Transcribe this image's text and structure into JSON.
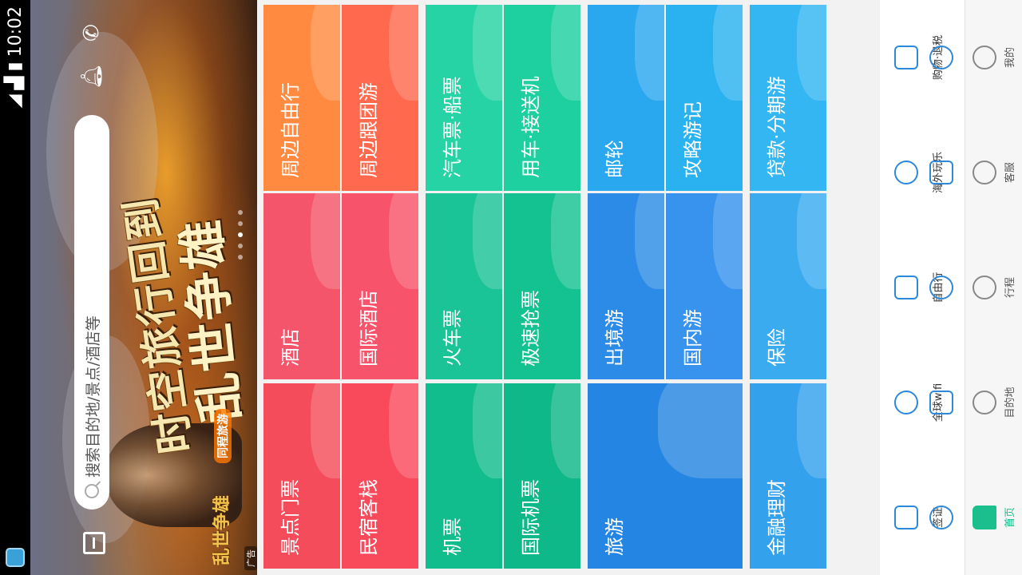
{
  "status_bar": {
    "time": "10:02"
  },
  "search": {
    "placeholder": "搜索目的地/景点/酒店等"
  },
  "banner": {
    "title_line1": "时空旅行回到",
    "title_line2": "乱世争雄",
    "game_logo": "乱世争雄",
    "sponsor": "同程旅游",
    "ad_tag": "广告",
    "page_count": 5,
    "active_page": 2
  },
  "blocks": [
    {
      "color": "#f34b59",
      "tiles": [
        {
          "label": "景点门票",
          "color": "#f44c5a"
        },
        {
          "label": "民宿客栈",
          "color": "#f94a5c"
        },
        {
          "label": "酒店",
          "color": "#f5556a"
        },
        {
          "label": "国际酒店",
          "color": "#f7536a"
        },
        {
          "label": "周边自由行",
          "color": "#ff8a40"
        },
        {
          "label": "周边跟团游",
          "color": "#ff6a4e"
        }
      ]
    },
    {
      "color": "#14c392",
      "tiles": [
        {
          "label": "机票",
          "color": "#12bd8d"
        },
        {
          "label": "国际机票",
          "color": "#0fb889"
        },
        {
          "label": "火车票",
          "color": "#1ac496"
        },
        {
          "label": "极速抢票",
          "color": "#14c291"
        },
        {
          "label": "汽车票·船票",
          "color": "#26d3a4"
        },
        {
          "label": "用车·接送机",
          "color": "#1ed0a0"
        }
      ]
    },
    {
      "color": "#2a90e6",
      "tiles": [
        {
          "label": "旅游",
          "color": "#2486e2"
        },
        {
          "label": "出境游",
          "color": "#2b8be6"
        },
        {
          "label": "国内游",
          "color": "#3893ee"
        },
        {
          "label": "邮轮",
          "color": "#2aa8ef"
        },
        {
          "label": "攻略游记",
          "color": "#2ab2f0"
        }
      ]
    },
    {
      "color": "#35a4ee",
      "tiles": [
        {
          "label": "金融理财",
          "color": "#34a1ec"
        },
        {
          "label": "保险",
          "color": "#3aabef"
        },
        {
          "label": "贷款·分期游",
          "color": "#33b6f2"
        }
      ]
    }
  ],
  "features": [
    {
      "label": "签证",
      "icon": "visa-icon"
    },
    {
      "label": "全球wifi",
      "icon": "wifi-icon"
    },
    {
      "label": "自由行",
      "icon": "suitcase-icon"
    },
    {
      "label": "海外玩乐",
      "icon": "balloon-icon"
    },
    {
      "label": "购物·退税",
      "icon": "cart-icon"
    },
    {
      "label": "",
      "icon": "map-pin-icon"
    },
    {
      "label": "",
      "icon": "cards-icon"
    },
    {
      "label": "",
      "icon": "crown-icon"
    },
    {
      "label": "",
      "icon": "tent-icon"
    },
    {
      "label": "",
      "icon": "grid-icon"
    }
  ],
  "tabs": [
    {
      "label": "首页",
      "icon": "home-icon",
      "active": true
    },
    {
      "label": "目的地",
      "icon": "compass-icon",
      "active": false
    },
    {
      "label": "行程",
      "icon": "calendar-icon",
      "active": false
    },
    {
      "label": "客服",
      "icon": "headset-icon",
      "active": false
    },
    {
      "label": "我的",
      "icon": "user-icon",
      "active": false
    }
  ]
}
